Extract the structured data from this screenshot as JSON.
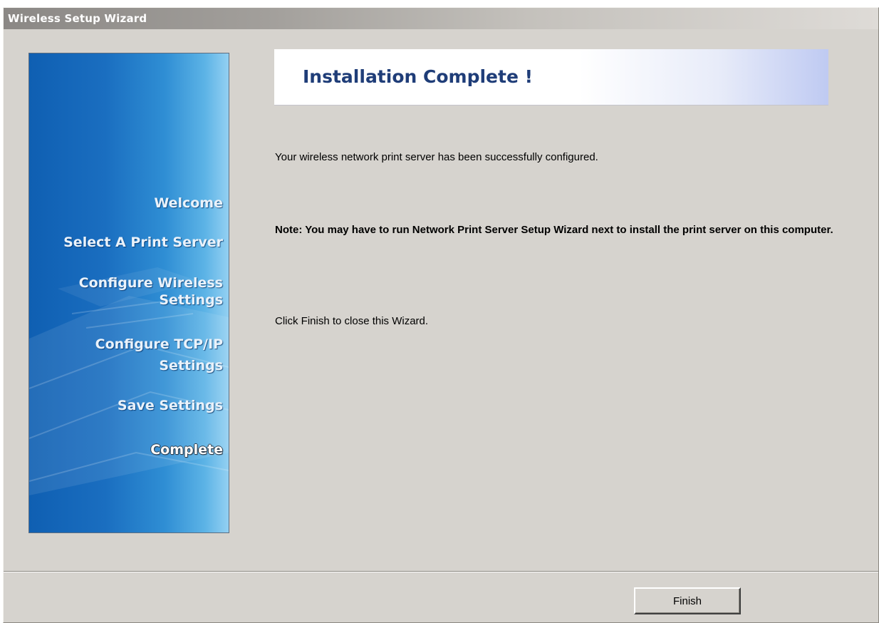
{
  "window": {
    "title": "Wireless Setup Wizard"
  },
  "sidebar": {
    "steps": [
      {
        "label": "Welcome",
        "active": false
      },
      {
        "label": "Select A Print Server",
        "active": false
      },
      {
        "label": "Configure Wireless\nSettings",
        "active": false
      },
      {
        "label": "Configure TCP/IP\nSettings",
        "active": false
      },
      {
        "label": "Save Settings",
        "active": false
      },
      {
        "label": "Complete",
        "active": true
      }
    ]
  },
  "header": {
    "title": "Installation Complete !"
  },
  "content": {
    "message": "Your wireless network print server has been successfully configured.",
    "note": "Note: You may have to run Network Print Server Setup Wizard next to install the print server on this computer.",
    "instruction": "Click Finish to close this Wizard."
  },
  "footer": {
    "finish_label": "Finish"
  },
  "colors": {
    "sidebar_blue": "#1a6ec0",
    "header_title": "#1f3d78",
    "dialog_bg": "#d6d3ce"
  }
}
